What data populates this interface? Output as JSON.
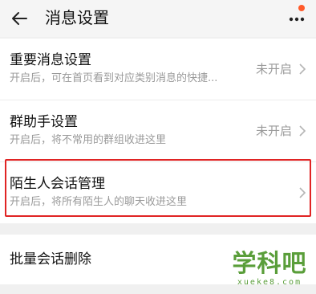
{
  "header": {
    "title": "消息设置",
    "back_icon": "arrow-left-icon",
    "more_icon": "more-dots-icon",
    "badge_color": "#ff5a2a"
  },
  "settings": [
    {
      "title": "重要消息设置",
      "desc": "开启后，可在首页看到对应类别消息的快捷...",
      "value": "未开启"
    },
    {
      "title": "群助手设置",
      "desc": "开启后，将不常用的群组收进这里",
      "value": "未开启"
    },
    {
      "title": "陌生人会话管理",
      "desc": "开启后，将所有陌生人的聊天收进这里",
      "value": ""
    }
  ],
  "batch_delete": {
    "title": "批量会话删除"
  },
  "highlight_color": "#e02424",
  "watermark": {
    "main": "学科吧",
    "sub": "xueke8.com"
  }
}
